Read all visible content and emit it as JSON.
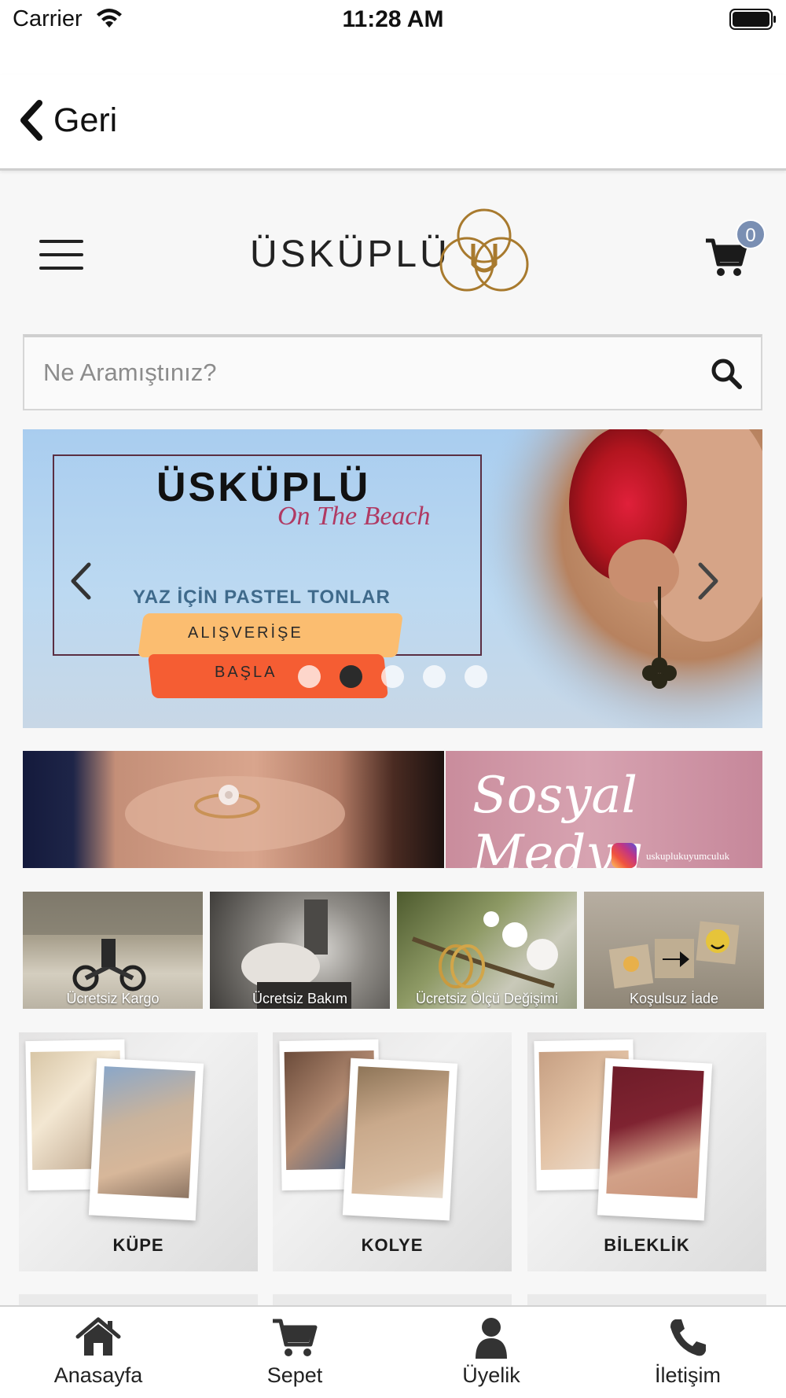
{
  "status_bar": {
    "carrier": "Carrier",
    "time": "11:28 AM"
  },
  "nav": {
    "back_label": "Geri"
  },
  "header": {
    "logo_text": "ÜSKÜPLÜ",
    "cart_count": "0"
  },
  "search": {
    "placeholder": "Ne Aramıştınız?"
  },
  "hero": {
    "brand": "ÜSKÜPLÜ",
    "subtitle": "On The Beach",
    "tagline": "YAZ İÇİN PASTEL TONLAR",
    "cta_line1": "ALIŞVERİŞE",
    "cta_line2": "BAŞLA",
    "slide_count": 5,
    "active_slide_index": 1
  },
  "promos": {
    "social_title": "Sosyal Medya",
    "social_handle": "uskuplukuyumculuk"
  },
  "features": [
    {
      "label": "Ücretsiz Kargo"
    },
    {
      "label": "Ücretsiz Bakım"
    },
    {
      "label": "Ücretsiz Ölçü Değişimi"
    },
    {
      "label": "Koşulsuz İade"
    }
  ],
  "categories": [
    {
      "label": "KÜPE"
    },
    {
      "label": "KOLYE"
    },
    {
      "label": "BİLEKLİK"
    }
  ],
  "tab_bar": {
    "tabs": [
      {
        "label": "Anasayfa",
        "icon": "home-icon"
      },
      {
        "label": "Sepet",
        "icon": "cart-icon"
      },
      {
        "label": "Üyelik",
        "icon": "user-icon"
      },
      {
        "label": "İletişim",
        "icon": "phone-icon"
      }
    ]
  },
  "colors": {
    "logo_gold": "#a87a2e",
    "cart_badge": "#7a8fb3",
    "hero_accent": "#b03a63",
    "cta_top": "#fbbd70",
    "cta_bottom": "#f55d33"
  }
}
